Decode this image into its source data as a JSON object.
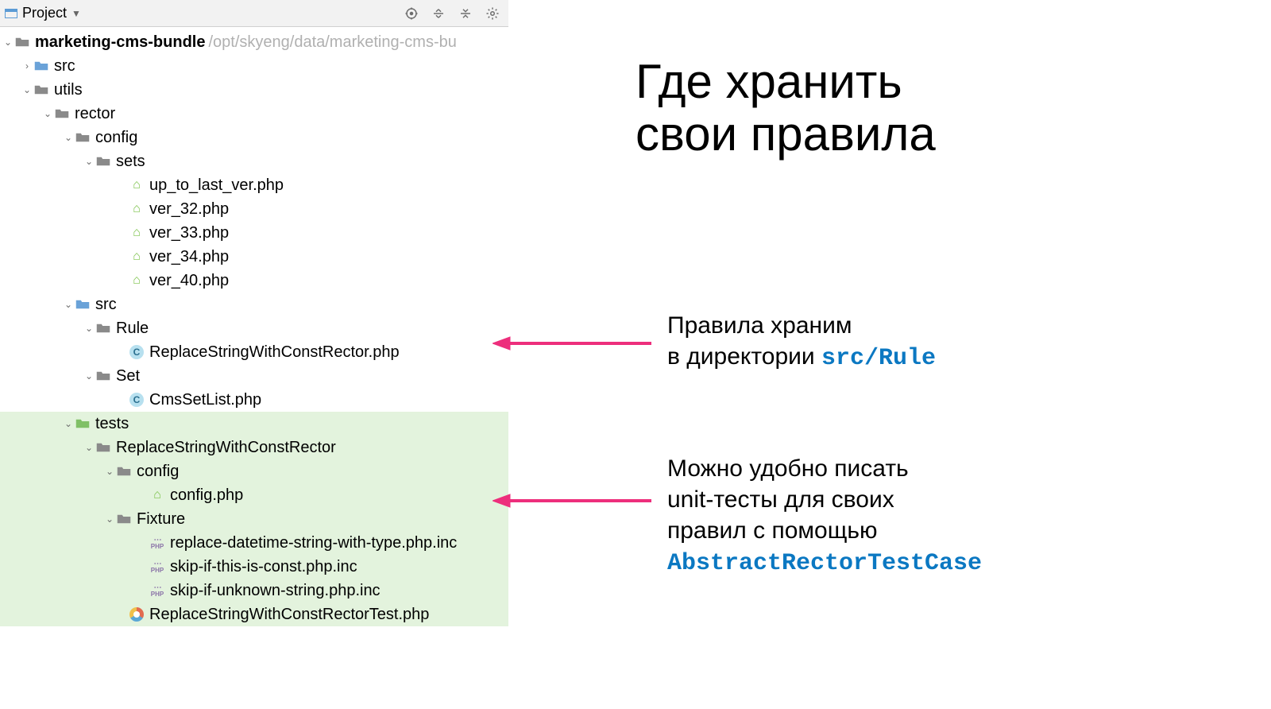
{
  "toolbar": {
    "view_label": "Project"
  },
  "root": {
    "name": "marketing-cms-bundle",
    "path": "/opt/skyeng/data/marketing-cms-bu"
  },
  "tree": {
    "src": "src",
    "utils": "utils",
    "rector": "rector",
    "config": "config",
    "sets": "sets",
    "files_sets": {
      "f0": "up_to_last_ver.php",
      "f1": "ver_32.php",
      "f2": "ver_33.php",
      "f3": "ver_34.php",
      "f4": "ver_40.php"
    },
    "rector_src": "src",
    "rule": "Rule",
    "rule_file": "ReplaceStringWithConstRector.php",
    "set": "Set",
    "set_file": "CmsSetList.php",
    "tests": "tests",
    "test_case": "ReplaceStringWithConstRector",
    "test_config": "config",
    "test_config_file": "config.php",
    "fixture": "Fixture",
    "fixture_files": {
      "f0": "replace-datetime-string-with-type.php.inc",
      "f1": "skip-if-this-is-const.php.inc",
      "f2": "skip-if-unknown-string.php.inc"
    },
    "test_file": "ReplaceStringWithConstRectorTest.php"
  },
  "slide": {
    "title_l1": "Где хранить",
    "title_l2": "свои правила",
    "ann1_l1": "Правила храним",
    "ann1_l2_pre": "в директории ",
    "ann1_code": "src/Rule",
    "ann2_l1": "Можно удобно писать",
    "ann2_l2": "unit-тесты для своих",
    "ann2_l3": "правил с помощью",
    "ann2_code": "AbstractRectorTestCase"
  }
}
